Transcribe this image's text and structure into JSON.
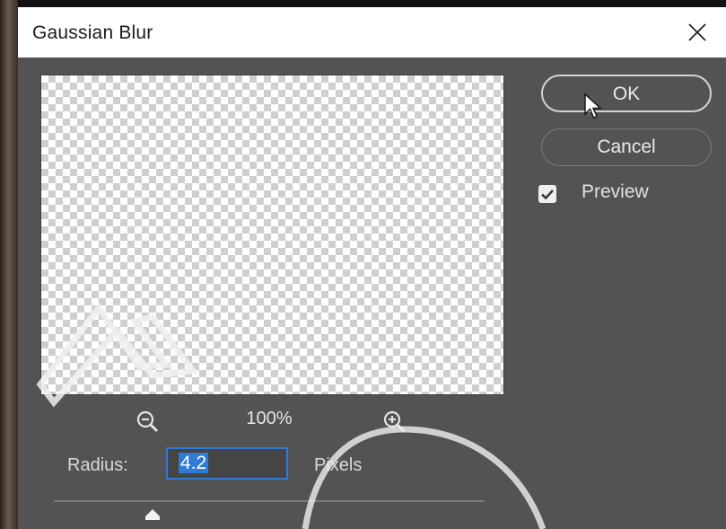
{
  "dialog": {
    "title": "Gaussian Blur"
  },
  "buttons": {
    "ok_label": "OK",
    "cancel_label": "Cancel"
  },
  "preview_option": {
    "label": "Preview",
    "checked": true
  },
  "zoom": {
    "level": "100%"
  },
  "radius": {
    "label": "Radius:",
    "value": "4.2",
    "unit": "Pixels"
  },
  "icons": {
    "close": "close-icon",
    "zoom_out": "zoom-out-icon",
    "zoom_in": "zoom-in-icon",
    "check": "checkmark-icon",
    "slider_thumb": "slider-thumb-icon",
    "cursor": "mouse-pointer-icon"
  },
  "colors": {
    "dialog_bg": "#535353",
    "titlebar_bg": "#ffffff",
    "selection_blue": "#2f7bd6",
    "button_border": "#7c7c7c"
  }
}
